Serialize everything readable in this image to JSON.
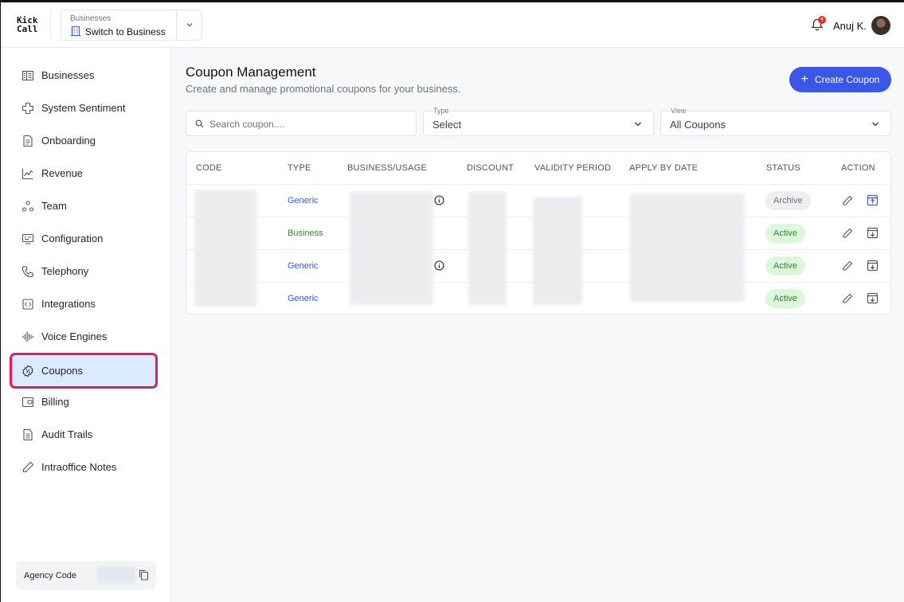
{
  "header": {
    "logo_line1": "Kick",
    "logo_line2": "Call",
    "business_switcher": {
      "caption": "Businesses",
      "value": "Switch to Business"
    },
    "notification_count": "4",
    "user_name": "Anuj K."
  },
  "sidebar": {
    "items": [
      {
        "label": "Businesses",
        "icon": "businesses-icon"
      },
      {
        "label": "System Sentiment",
        "icon": "sentiment-icon"
      },
      {
        "label": "Onboarding",
        "icon": "onboarding-icon"
      },
      {
        "label": "Revenue",
        "icon": "revenue-icon"
      },
      {
        "label": "Team",
        "icon": "team-icon"
      },
      {
        "label": "Configuration",
        "icon": "configuration-icon"
      },
      {
        "label": "Telephony",
        "icon": "phone-icon"
      },
      {
        "label": "Integrations",
        "icon": "integrations-icon"
      },
      {
        "label": "Voice Engines",
        "icon": "waveform-icon"
      },
      {
        "label": "Coupons",
        "icon": "coupon-icon",
        "active": true
      },
      {
        "label": "Billing",
        "icon": "wallet-icon"
      },
      {
        "label": "Audit Trails",
        "icon": "document-icon"
      },
      {
        "label": "Intraoffice Notes",
        "icon": "pencil-icon"
      }
    ],
    "agency_code_label": "Agency Code"
  },
  "main": {
    "title": "Coupon Management",
    "subtitle": "Create and manage promotional coupons for your business.",
    "create_button": "Create Coupon",
    "search_placeholder": "Search coupon....",
    "type_filter": {
      "caption": "Type",
      "value": "Select"
    },
    "view_filter": {
      "caption": "View",
      "value": "All Coupons"
    },
    "table": {
      "columns": [
        "CODE",
        "TYPE",
        "BUSINESS/USAGE",
        "DISCOUNT",
        "VALIDITY PERIOD",
        "APPLY BY DATE",
        "STATUS",
        "ACTION"
      ],
      "rows": [
        {
          "type": "Generic",
          "status": "Archive"
        },
        {
          "type": "Business",
          "status": "Active"
        },
        {
          "type": "Generic",
          "status": "Active"
        },
        {
          "type": "Generic",
          "status": "Active"
        }
      ]
    }
  },
  "colors": {
    "accent": "#3a57e8",
    "active_nav_bg": "#dbeafe",
    "highlight_outline": "#e8195a",
    "status_active": "#2e8a33",
    "status_archive": "#6b7280"
  }
}
